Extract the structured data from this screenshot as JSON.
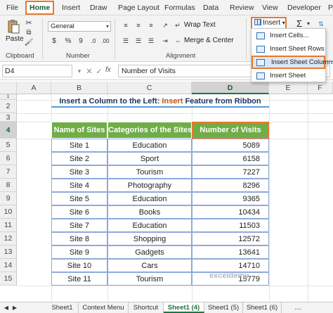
{
  "menu_tabs": [
    "File",
    "Home",
    "Insert",
    "Draw",
    "Page Layout",
    "Formulas",
    "Data",
    "Review",
    "View",
    "Developer",
    "P"
  ],
  "ribbon": {
    "paste_label": "Paste",
    "clipboard_label": "Clipboard",
    "number_format": "General",
    "number_label": "Number",
    "wrap_text": "Wrap Text",
    "merge_center": "Merge & Center",
    "alignment_label": "Alignment",
    "insert_label": "Insert",
    "sigma": "Σ",
    "accent_color": "#e8792c"
  },
  "insert_menu": [
    "Insert Cells...",
    "Insert Sheet Rows",
    "Insert Sheet Columns",
    "Insert Sheet"
  ],
  "formula_bar": {
    "name_box": "D4",
    "fx": "fx",
    "content": "Number of Visits"
  },
  "columns": [
    "A",
    "B",
    "C",
    "D",
    "E",
    "F"
  ],
  "rows": [
    "1",
    "2",
    "3",
    "4",
    "5",
    "6",
    "7",
    "8",
    "9",
    "10",
    "11",
    "12",
    "13",
    "14",
    "15"
  ],
  "title": {
    "part1": "Insert a Column to the Left: ",
    "part2": "Insert",
    "part3": " Feature from Ribbon"
  },
  "table": {
    "headers": [
      "Name of Sites",
      "Categories of the Sites",
      "Number of Visits"
    ],
    "rows": [
      [
        "Site 1",
        "Education",
        "5089"
      ],
      [
        "Site 2",
        "Sport",
        "6158"
      ],
      [
        "Site 3",
        "Tourism",
        "7227"
      ],
      [
        "Site 4",
        "Photography",
        "8296"
      ],
      [
        "Site 5",
        "Education",
        "9365"
      ],
      [
        "Site 6",
        "Books",
        "10434"
      ],
      [
        "Site 7",
        "Education",
        "11503"
      ],
      [
        "Site 8",
        "Shopping",
        "12572"
      ],
      [
        "Site 9",
        "Gadgets",
        "13641"
      ],
      [
        "Site 10",
        "Cars",
        "14710"
      ],
      [
        "Site 11",
        "Tourism",
        "15779"
      ]
    ]
  },
  "sheet_tabs": [
    "Sheet1",
    "Context Menu",
    "Shortcut",
    "Sheet1 (4)",
    "Sheet1 (5)",
    "Sheet1 (6)"
  ],
  "watermark": "exceldemy"
}
